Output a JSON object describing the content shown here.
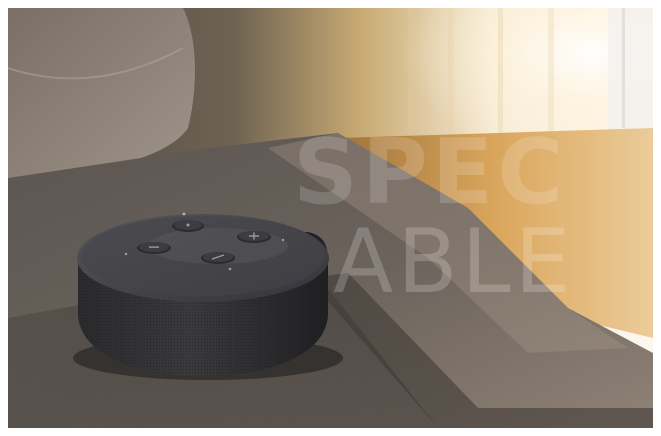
{
  "watermark": {
    "line1": "SPEC",
    "line2": "ABLE"
  },
  "colors": {
    "window_light": "#fbf4e6",
    "floor_wood": "#c48b3f",
    "table_surface": "#5a5450",
    "speaker_fabric": "#2f2f31",
    "speaker_top": "#3d3d40"
  },
  "icons": [
    "action-button-icon",
    "volume-down-icon",
    "volume-up-icon",
    "mic-off-icon"
  ]
}
